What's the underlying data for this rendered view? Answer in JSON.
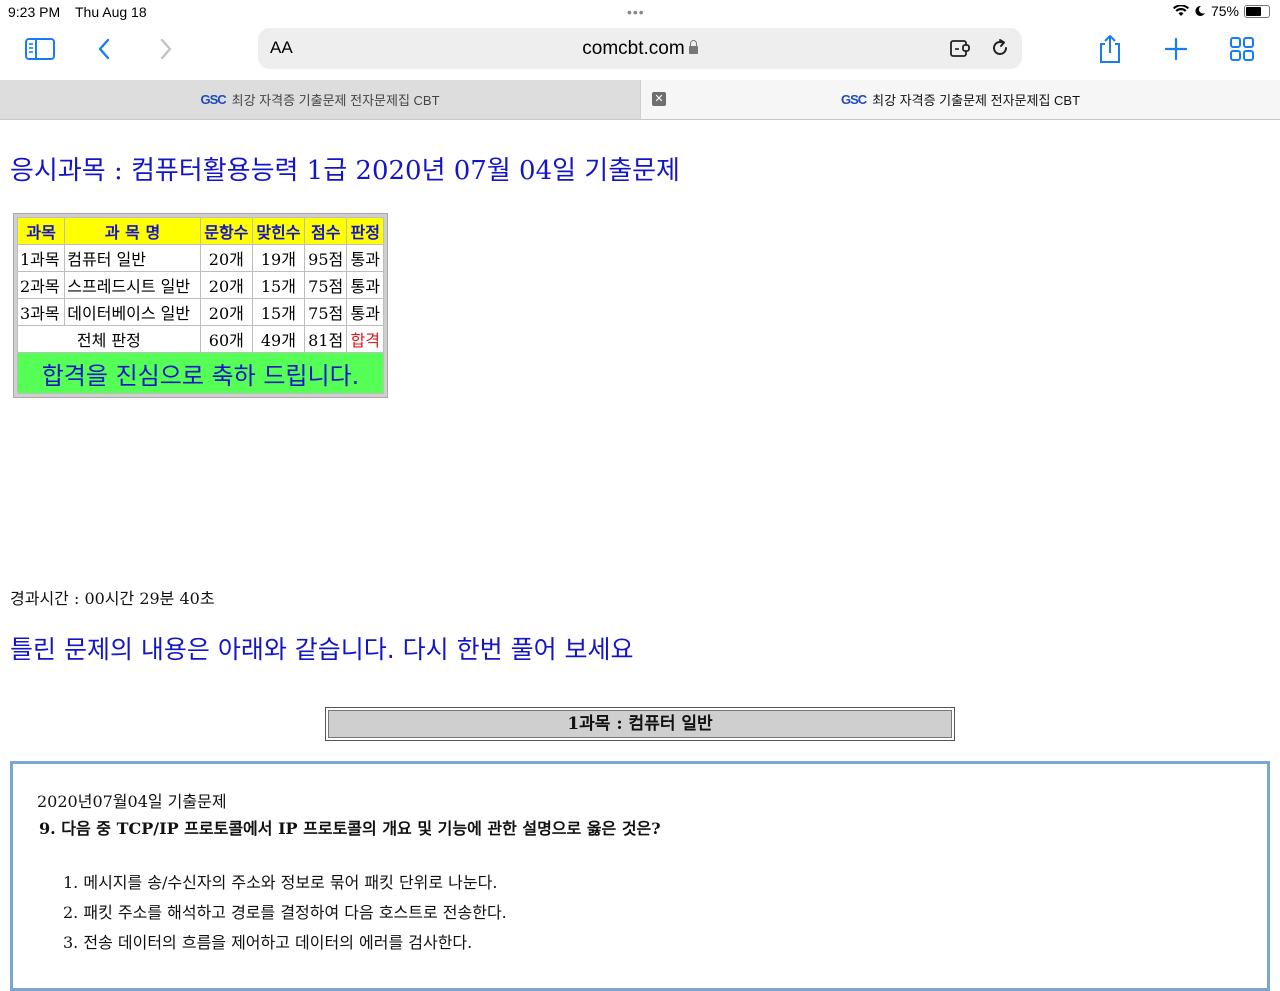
{
  "status": {
    "time": "9:23 PM",
    "date": "Thu Aug 18",
    "battery": "75%",
    "battery_level": 0.75
  },
  "toolbar": {
    "text_size_label": "AA",
    "url": "comcbt.com"
  },
  "tabs": [
    {
      "favicon": "GSC",
      "title": "최강 자격증 기출문제 전자문제집 CBT"
    },
    {
      "favicon": "GSC",
      "title": "최강 자격증 기출문제 전자문제집 CBT"
    }
  ],
  "page": {
    "headline": "응시과목 : 컴퓨터활용능력 1급 2020년 07월 04일 기출문제",
    "score_table": {
      "headers": [
        "과목",
        "과 목 명",
        "문항수",
        "맞힌수",
        "점수",
        "판정"
      ],
      "rows": [
        [
          "1과목",
          "컴퓨터 일반",
          "20개",
          "19개",
          "95점",
          "통과"
        ],
        [
          "2과목",
          "스프레드시트 일반",
          "20개",
          "15개",
          "75점",
          "통과"
        ],
        [
          "3과목",
          "데이터베이스 일반",
          "20개",
          "15개",
          "75점",
          "통과"
        ]
      ],
      "total": {
        "label": "전체 판정",
        "count": "60개",
        "correct": "49개",
        "score": "81점",
        "result": "합격"
      },
      "congrats": "합격을 진심으로 축하 드립니다."
    },
    "elapsed": "경과시간 : 00시간 29분 40초",
    "wrong_title": "틀린 문제의 내용은 아래와 같습니다. 다시 한번 풀어 보세요",
    "subject_bar": "1과목 : 컴퓨터 일반",
    "question": {
      "exam_date": "2020년07월04일 기출문제",
      "text": "9. 다음 중 TCP/IP 프로토콜에서 IP 프로토콜의 개요 및 기능에 관한 설명으로 옳은 것은?",
      "options": [
        "1. 메시지를 송/수신자의 주소와 정보로 묶어 패킷 단위로 나눈다.",
        "2. 패킷 주소를 해석하고 경로를 결정하여 다음 호스트로 전송한다.",
        "3. 전송 데이터의 흐름을 제어하고 데이터의 에러를 검사한다."
      ]
    }
  }
}
